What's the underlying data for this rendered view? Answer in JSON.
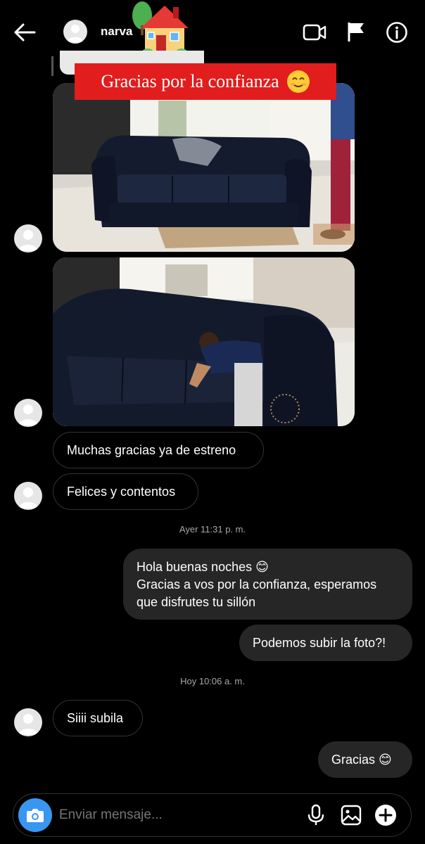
{
  "header": {
    "username": "narva",
    "back": "back-arrow-icon",
    "video": "video-icon",
    "flag": "flag-icon",
    "info": "info-icon"
  },
  "banner": {
    "text": "Gracias por la confianza",
    "emoji": "smiling-face-emoji"
  },
  "messages": [
    {
      "side": "in",
      "text": "Muchas gracias ya de estreno"
    },
    {
      "side": "in",
      "text": "Felices y contentos"
    },
    {
      "side": "out",
      "lines": [
        "Hola buenas noches 😊",
        "Gracias a vos por la confianza, esperamos",
        "que disfrutes tu sillón"
      ]
    },
    {
      "side": "out",
      "text": "Podemos subir la foto?!"
    },
    {
      "side": "in",
      "text": "Siiii subila"
    },
    {
      "side": "out",
      "text": "Gracias 😊"
    }
  ],
  "timestamps": [
    "Ayer 11:31 p. m.",
    "Hoy 10:06 a. m."
  ],
  "composer": {
    "placeholder": "Enviar mensaje..."
  },
  "colors": {
    "accent": "#3897f0",
    "banner": "#e11d1d",
    "bubble_out": "#262626",
    "background": "#000000"
  }
}
